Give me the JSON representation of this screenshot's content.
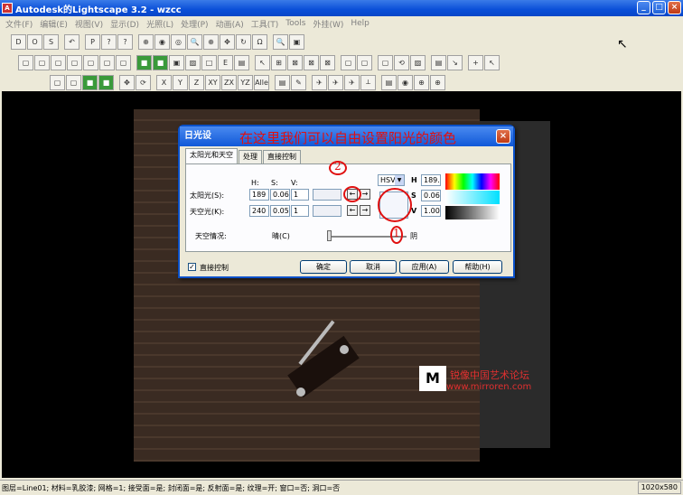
{
  "window": {
    "title": "Autodesk的Lightscape 3.2 - wzcc",
    "app_icon_label": "A"
  },
  "window_buttons": {
    "minimize": "_",
    "maximize": "□",
    "close": "×"
  },
  "menu": [
    "文件(F)",
    "编辑(E)",
    "视图(V)",
    "显示(D)",
    "光照(L)",
    "处理(P)",
    "动画(A)",
    "工具(T)",
    "Tools",
    "外挂(W)",
    "Help"
  ],
  "toolbar": {
    "row1": [
      "D",
      "O",
      "S",
      "|",
      "↶",
      "|",
      "P",
      "?",
      "?",
      "|",
      "⊕",
      "◉",
      "◎",
      "🔍",
      "⊕",
      "✥",
      "↻",
      "Ω",
      "|",
      "🔍",
      "▣"
    ],
    "row2": [
      "▢",
      "▢",
      "▢",
      "▢",
      "▢",
      "▢",
      "▢",
      "|",
      "■",
      "■",
      "▣",
      "▨",
      "□",
      "E",
      "▤",
      "|",
      "↖",
      "⊞",
      "⊠",
      "⊠",
      "⊠",
      "|",
      "▢",
      "▢",
      "|",
      "▢",
      "⟲",
      "▨",
      "|",
      "▤",
      "↘",
      "|",
      "+",
      "↖"
    ],
    "row3": [
      "▢",
      "▢",
      "■",
      "■",
      "|",
      "✥",
      "⟳",
      "|",
      "X",
      "Y",
      "Z",
      "XY",
      "ZX",
      "YZ",
      "Alle",
      "|",
      "▤",
      "✎",
      "|",
      "✈",
      "✈",
      "✈",
      "⟂",
      "|",
      "▤",
      "◉",
      "⊕",
      "⊕"
    ]
  },
  "dialog": {
    "title": "日光设",
    "close": "×",
    "annotation_top": "在这里我们可以自由设置阳光的颜色",
    "tabs": [
      "太阳光和天空",
      "处理",
      "直接控制"
    ],
    "hsv_header": {
      "h": "H:",
      "s": "S:",
      "v": "V:"
    },
    "sun": {
      "label": "太阳光(S):",
      "h": "189",
      "s": "0.06",
      "v": "1"
    },
    "sky": {
      "label": "天空光(K):",
      "h": "240",
      "s": "0.05",
      "v": "1"
    },
    "arrow_left": "←",
    "arrow_right": "→",
    "color_mode": "HSV",
    "color_mode_arrow": "▼",
    "right_fields": {
      "h_label": "H",
      "h": "189.",
      "s_label": "S",
      "s": "0.06",
      "v_label": "V",
      "v": "1.00"
    },
    "sky_condition_label": "天空情况:",
    "sky_condition_left": "晴(C)",
    "sky_condition_right": "阴",
    "annotation_1": "1",
    "annotation_2": "2",
    "direct_control_label": "直接控制",
    "checkbox_mark": "✓",
    "buttons": {
      "ok": "确定",
      "cancel": "取消",
      "apply": "应用(A)",
      "help": "帮助(H)"
    }
  },
  "watermark": {
    "logo": "M",
    "text": "锐像中国艺术论坛",
    "url": "www.mirroren.com"
  },
  "status": {
    "text": "图层=Line01; 材料=乳胶漆; 网格=1; 接受面=是; 封闭面=是; 反射面=是; 纹理=开; 窗口=否; 洞口=否",
    "size": "1020x580"
  }
}
